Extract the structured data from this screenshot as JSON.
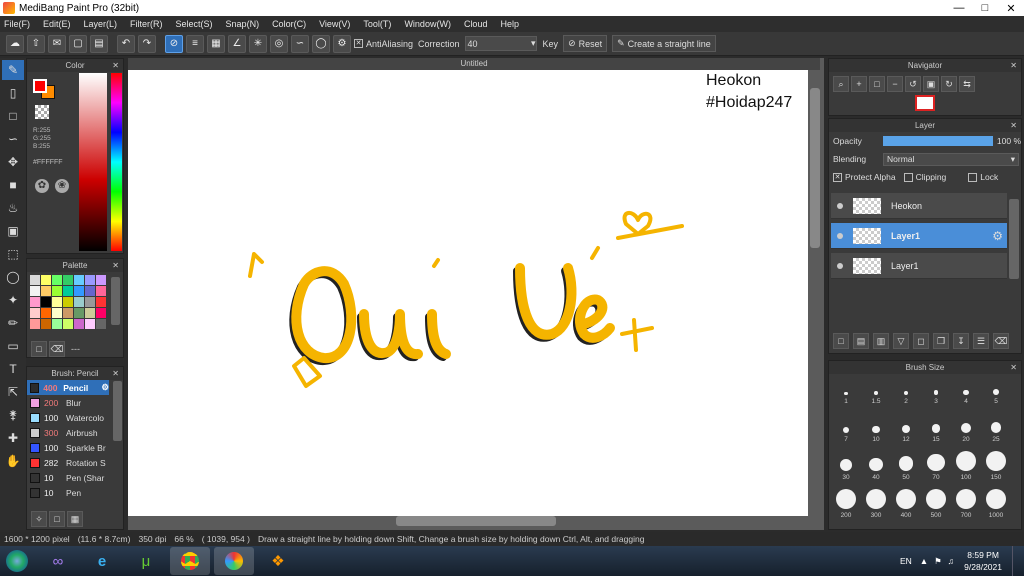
{
  "window": {
    "title": "MediBang Paint Pro (32bit)"
  },
  "menu": [
    "File(F)",
    "Edit(E)",
    "Layer(L)",
    "Filter(R)",
    "Select(S)",
    "Snap(N)",
    "Color(C)",
    "View(V)",
    "Tool(T)",
    "Window(W)",
    "Cloud",
    "Help"
  ],
  "toolbar": {
    "antialiasing_label": "AntiAliasing",
    "correction_label": "Correction",
    "correction_value": "40",
    "key_label": "Key",
    "reset_label": "Reset",
    "straight_line_label": "Create a straight line"
  },
  "color_panel": {
    "title": "Color",
    "r": "R:255",
    "g": "G:255",
    "b": "B:255",
    "hex": "#FFFFFF",
    "primary": "#ff0000",
    "secondary": "#ff8c00"
  },
  "palette": {
    "title": "Palette",
    "dash": "---",
    "colors": [
      "#d9d9d9",
      "#ffff66",
      "#66ff66",
      "#33cc66",
      "#66ccff",
      "#9999ff",
      "#cc99ff",
      "#f2f2f2",
      "#ffcc66",
      "#99ff33",
      "#00cc99",
      "#3399ff",
      "#6666cc",
      "#ff6699",
      "#ff99cc",
      "#000000",
      "#ffff99",
      "#cccc00",
      "#99cccc",
      "#999999",
      "#ff3333",
      "#ffcccc",
      "#ff6600",
      "#ffffcc",
      "#cc9966",
      "#669966",
      "#cccc99",
      "#ff0066",
      "#ff9999",
      "#cc6600",
      "#99ff99",
      "#ccff66",
      "#cc66cc",
      "#ffccff",
      "#666666"
    ]
  },
  "brush_panel": {
    "title": "Brush: Pencil",
    "items": [
      {
        "size": "400",
        "name": "Pencil",
        "color": "#2b2b2b",
        "selected": true
      },
      {
        "size": "200",
        "name": "Blur",
        "color": "#f0a0e0",
        "selected": false
      },
      {
        "size": "100",
        "name": "Watercolo",
        "color": "#99ddff",
        "selected": false
      },
      {
        "size": "300",
        "name": "Airbrush",
        "color": "#cccccc",
        "selected": false
      },
      {
        "size": "100",
        "name": "Sparkle Br",
        "color": "#3355ff",
        "selected": false
      },
      {
        "size": "282",
        "name": "Rotation S",
        "color": "#ff3333",
        "selected": false
      },
      {
        "size": "10",
        "name": "Pen (Shar",
        "color": "#333333",
        "selected": false
      },
      {
        "size": "10",
        "name": "Pen",
        "color": "#333333",
        "selected": false
      }
    ]
  },
  "canvas": {
    "tab_title": "Untitled",
    "overlay_line1": "Heokon",
    "overlay_line2": "#Hoidap247",
    "stroke_color": "#f5b400"
  },
  "navigator": {
    "title": "Navigator"
  },
  "layer_panel": {
    "title": "Layer",
    "opacity_label": "Opacity",
    "opacity_value": "100 %",
    "opacity_fraction": 1.0,
    "blending_label": "Blending",
    "blending_value": "Normal",
    "protect_alpha": "Protect Alpha",
    "clipping": "Clipping",
    "lock": "Lock",
    "layers": [
      {
        "name": "Heokon",
        "selected": false
      },
      {
        "name": "Layer1",
        "selected": true
      },
      {
        "name": "Layer1",
        "selected": false
      }
    ]
  },
  "brush_size_panel": {
    "title": "Brush Size",
    "sizes": [
      "1",
      "1.5",
      "2",
      "3",
      "4",
      "5",
      "7",
      "10",
      "12",
      "15",
      "20",
      "25",
      "30",
      "40",
      "50",
      "70",
      "100",
      "150",
      "200",
      "300",
      "400",
      "500",
      "700",
      "1000"
    ]
  },
  "status": {
    "size": "1600 * 1200 pixel",
    "cm": "(11.6 * 8.7cm)",
    "dpi": "350 dpi",
    "zoom": "66 %",
    "coords": "( 1039, 954 )",
    "hint": "Draw a straight line by holding down Shift, Change a brush size by holding down Ctrl, Alt, and dragging"
  },
  "taskbar": {
    "lang": "EN",
    "time": "8:59 PM",
    "date": "9/28/2021"
  }
}
